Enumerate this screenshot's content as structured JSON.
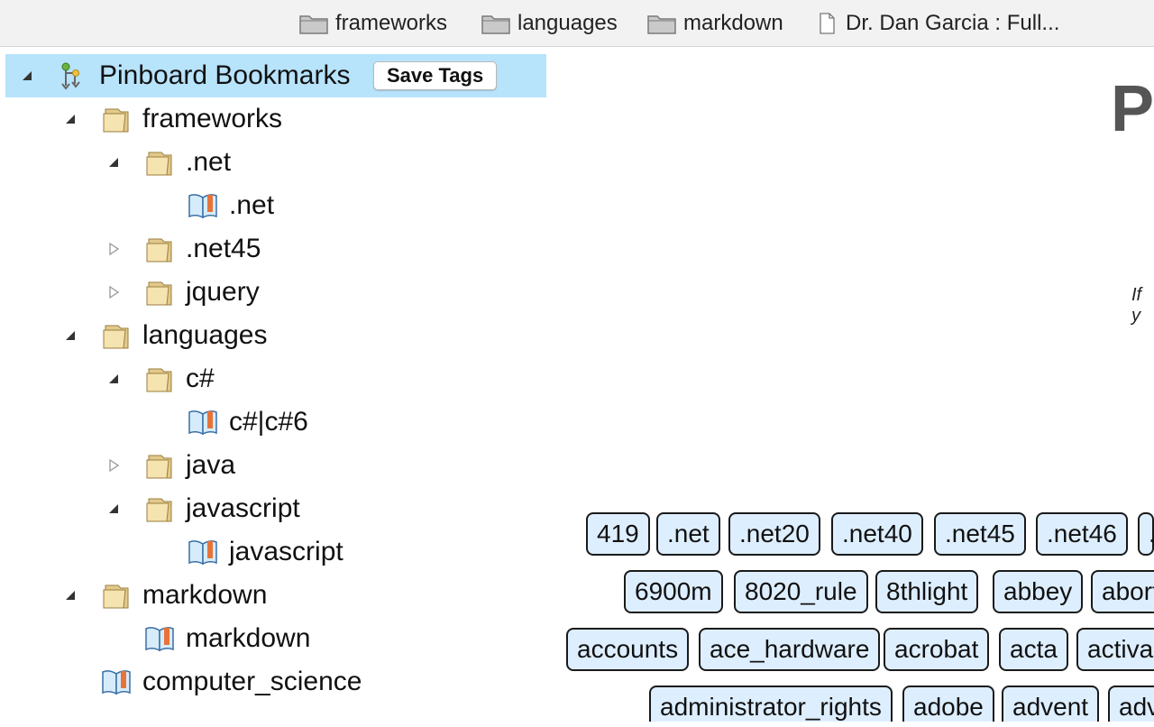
{
  "bookmarks_bar": {
    "items": [
      {
        "label": "frameworks",
        "icon": "folder-icon"
      },
      {
        "label": "languages",
        "icon": "folder-icon"
      },
      {
        "label": "markdown",
        "icon": "folder-icon"
      },
      {
        "label": "Dr. Dan Garcia : Full...",
        "icon": "page-icon"
      }
    ]
  },
  "tree": {
    "root": {
      "label": "Pinboard Bookmarks",
      "icon": "bookmarks-root-icon",
      "expanded": true
    },
    "save_button": "Save Tags",
    "nodes": [
      {
        "label": "frameworks",
        "type": "folder",
        "expanded": true
      },
      {
        "label": ".net",
        "type": "folder",
        "expanded": true
      },
      {
        "label": ".net",
        "type": "bookmark"
      },
      {
        "label": ".net45",
        "type": "folder",
        "expanded": false
      },
      {
        "label": "jquery",
        "type": "folder",
        "expanded": false
      },
      {
        "label": "languages",
        "type": "folder",
        "expanded": true
      },
      {
        "label": "c#",
        "type": "folder",
        "expanded": true
      },
      {
        "label": "c#|c#6",
        "type": "bookmark"
      },
      {
        "label": "java",
        "type": "folder",
        "expanded": false
      },
      {
        "label": "javascript",
        "type": "folder",
        "expanded": true
      },
      {
        "label": "javascript",
        "type": "bookmark"
      },
      {
        "label": "markdown",
        "type": "folder",
        "expanded": true
      },
      {
        "label": "markdown",
        "type": "bookmark"
      },
      {
        "label": "computer_science",
        "type": "bookmark"
      }
    ]
  },
  "right_panel": {
    "title_fragment": "Pi",
    "note_fragment": "If y"
  },
  "tags": {
    "row1": [
      "419",
      ".net",
      ".net20",
      ".net40",
      ".net45",
      ".net46",
      "."
    ],
    "row2": [
      "6900m",
      "8020_rule",
      "8thlight",
      "abbey",
      "abort"
    ],
    "row3": [
      "accounts",
      "ace_hardware",
      "acrobat",
      "acta",
      "activa"
    ],
    "row4": [
      "administrator_rights",
      "adobe",
      "advent",
      "adv"
    ]
  },
  "colors": {
    "selection": "#b7e3fb",
    "tag_bg": "#ddeefe",
    "bar_bg": "#f2f2f2"
  }
}
